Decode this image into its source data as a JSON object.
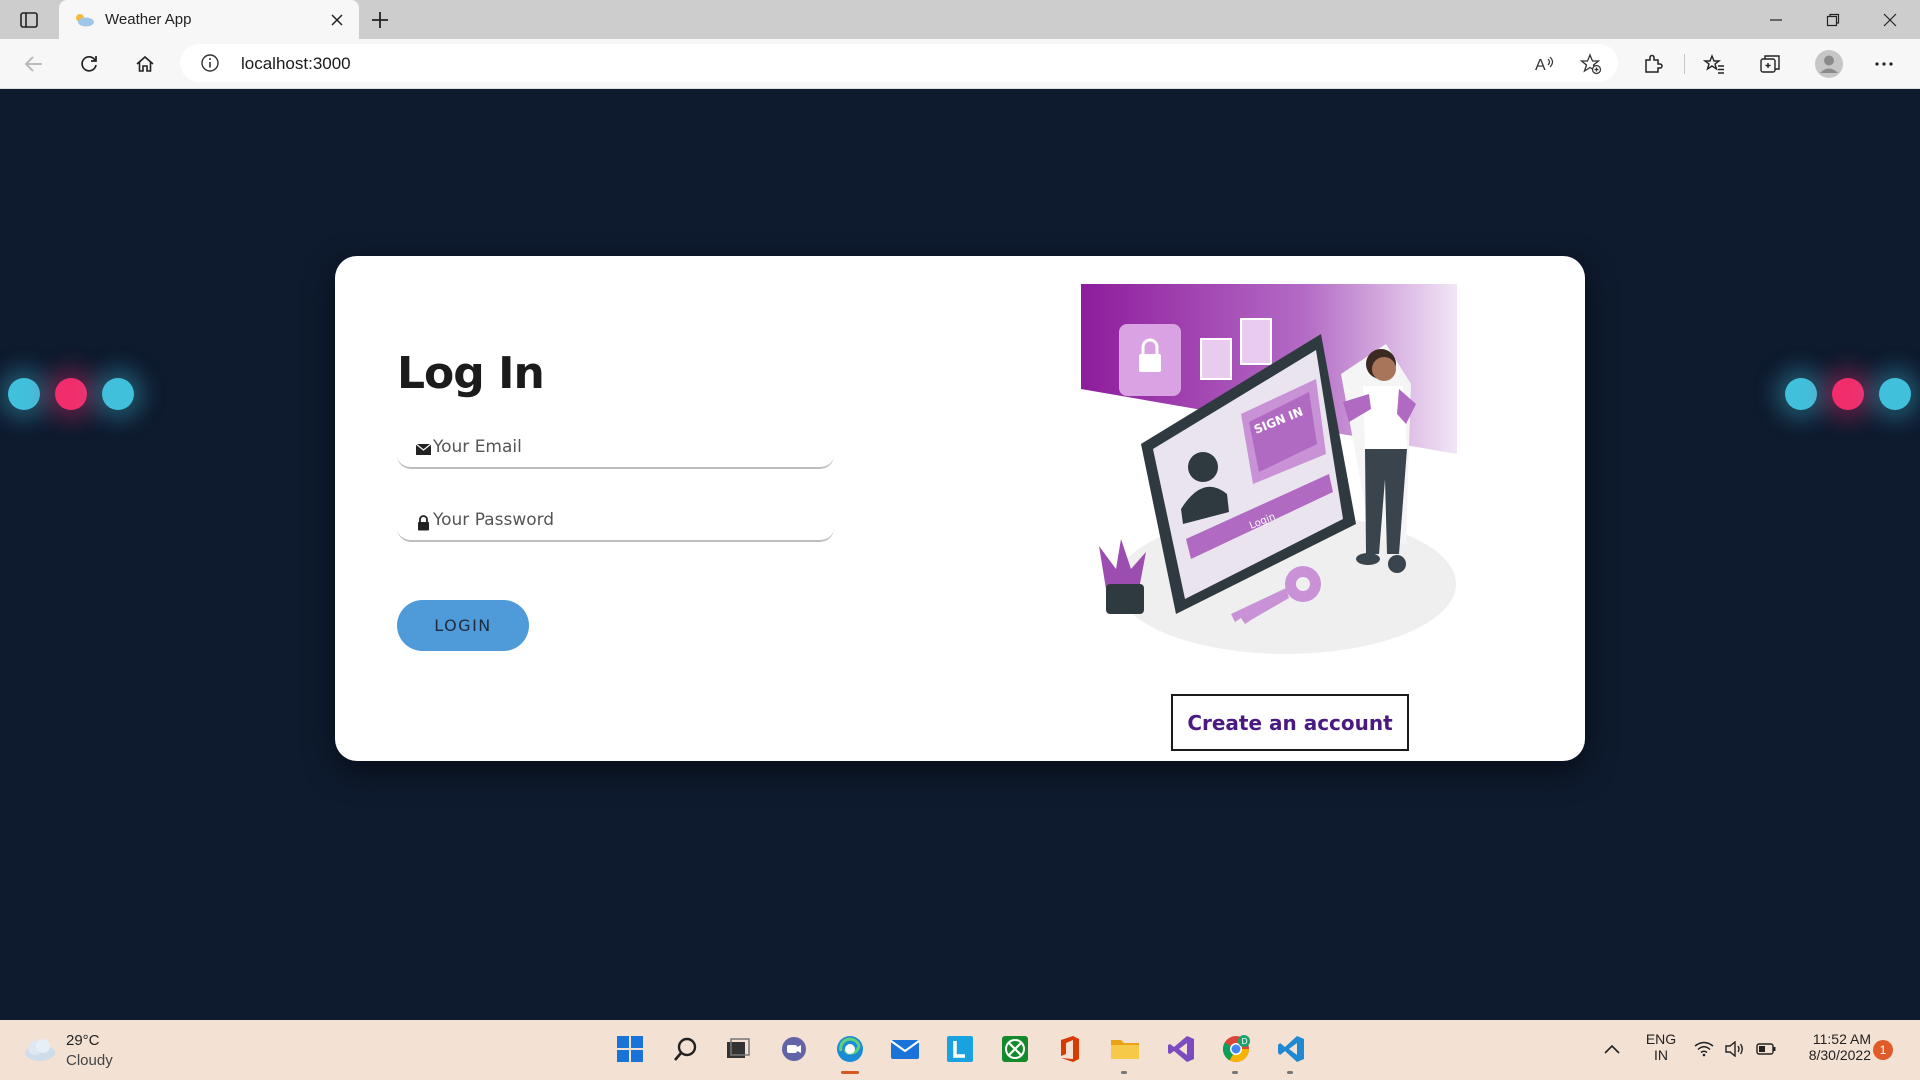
{
  "browser": {
    "tab_title": "Weather App",
    "url": "localhost:3000"
  },
  "login": {
    "heading": "Log In",
    "email_placeholder": "Your Email",
    "email_value": "",
    "password_placeholder": "Your Password",
    "password_value": "",
    "login_button": "LOGIN",
    "create_account_button": "Create an account"
  },
  "illustration": {
    "sign_in_text": "SIGN IN",
    "login_text": "Login"
  },
  "taskbar": {
    "weather_temp": "29°C",
    "weather_condition": "Cloudy",
    "language_line1": "ENG",
    "language_line2": "IN",
    "time": "11:52 AM",
    "date": "8/30/2022",
    "notification_count": "1"
  },
  "colors": {
    "page_background": "#0e1a2e",
    "login_button": "#4f9ad8",
    "create_account_text": "#4a1a82",
    "dot_blue": "#41c0db",
    "dot_pink": "#f22d6c",
    "illustration_purple": "#8e1c9c"
  }
}
